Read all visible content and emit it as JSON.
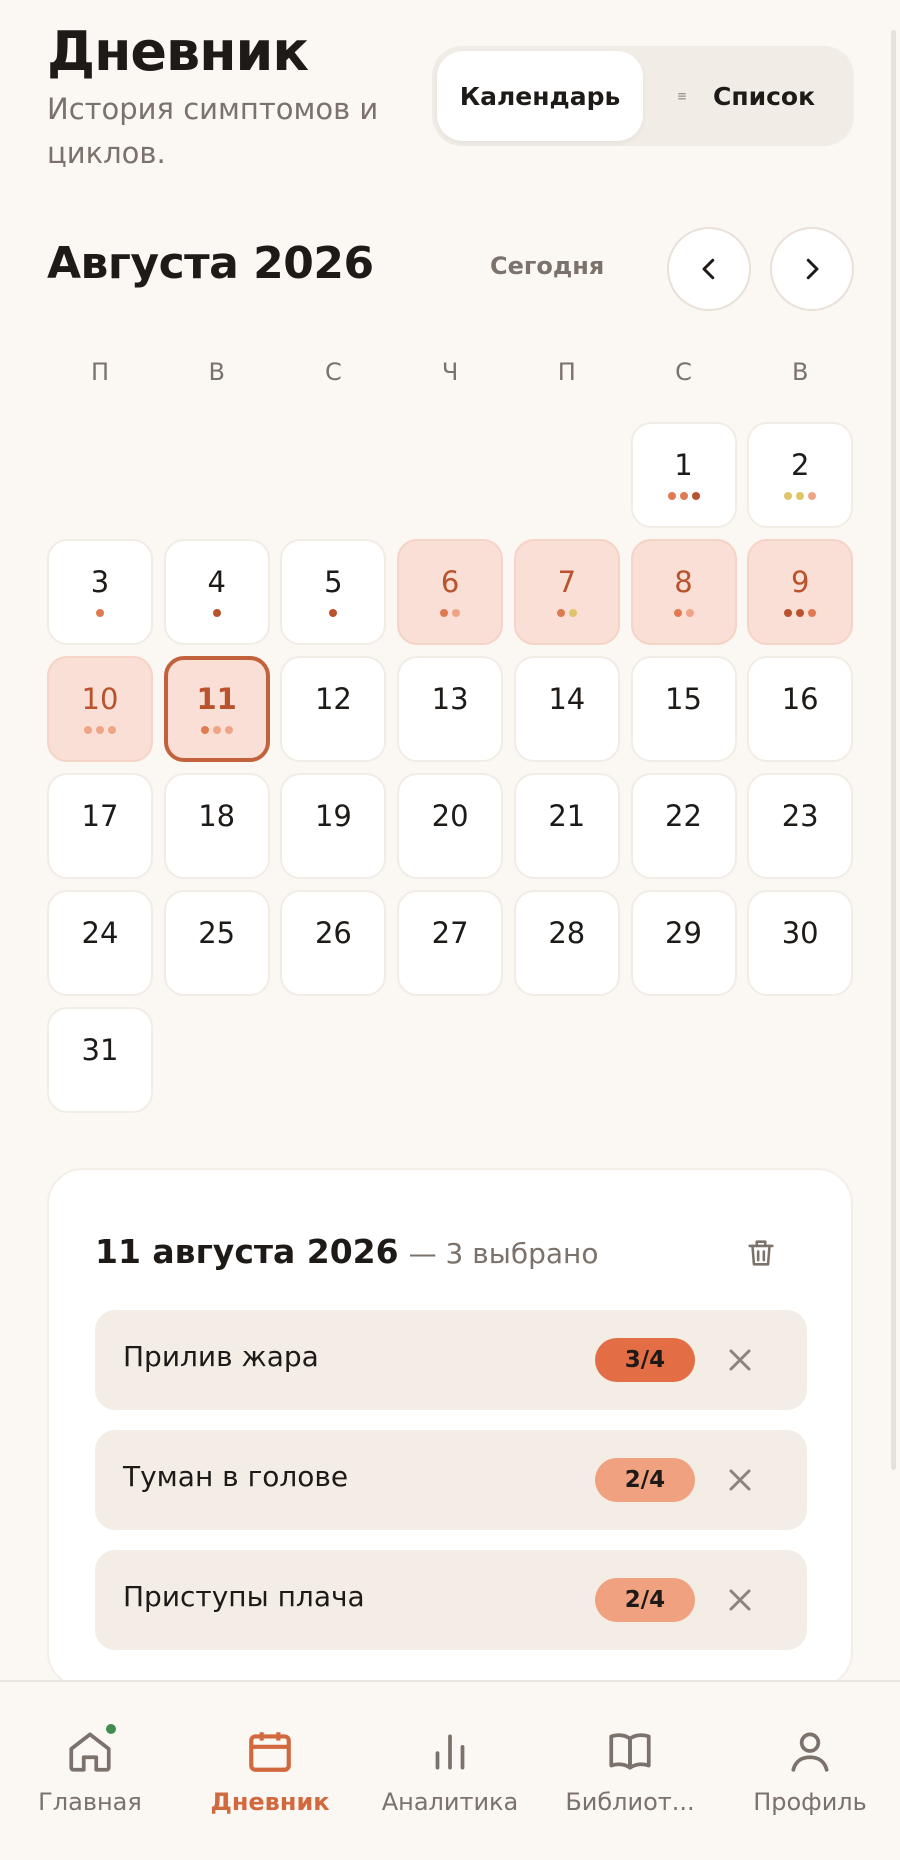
{
  "header": {
    "title": "Дневник",
    "subtitle": "История симптомов и циклов.",
    "view_calendar": "Календарь",
    "view_list": "Список"
  },
  "month": {
    "title": "Августа 2026",
    "today_label": "Сегодня"
  },
  "weekdays": [
    "П",
    "В",
    "С",
    "Ч",
    "П",
    "С",
    "В"
  ],
  "colors": {
    "accent": "#D2683E",
    "period_fill": "#F9DFD5",
    "selected_border": "#C2623C",
    "dot_dark": "#B9532D",
    "dot_mid": "#E07A50",
    "dot_light": "#EFA585",
    "dot_yellow": "#E1C46A",
    "badge_high": "#E36E45",
    "badge_mid": "#F0A17F",
    "notification": "#3E8E4F"
  },
  "days": [
    {
      "n": "1",
      "type": "normal",
      "dots": [
        "#E07A50",
        "#E07A50",
        "#B9532D"
      ]
    },
    {
      "n": "2",
      "type": "normal",
      "dots": [
        "#E1C46A",
        "#E1C46A",
        "#EFA585"
      ]
    },
    {
      "n": "3",
      "type": "normal",
      "dots": [
        "#E07A50"
      ]
    },
    {
      "n": "4",
      "type": "normal",
      "dots": [
        "#B9532D"
      ]
    },
    {
      "n": "5",
      "type": "normal",
      "dots": [
        "#B9532D"
      ]
    },
    {
      "n": "6",
      "type": "period",
      "dots": [
        "#E07A50",
        "#EFA585"
      ]
    },
    {
      "n": "7",
      "type": "period",
      "dots": [
        "#E07A50",
        "#E1C46A"
      ]
    },
    {
      "n": "8",
      "type": "period",
      "dots": [
        "#E07A50",
        "#EFA585"
      ]
    },
    {
      "n": "9",
      "type": "period",
      "dots": [
        "#B9532D",
        "#B9532D",
        "#E07A50"
      ]
    },
    {
      "n": "10",
      "type": "period",
      "dots": [
        "#EFA585",
        "#EFA585",
        "#EFA585"
      ]
    },
    {
      "n": "11",
      "type": "selected",
      "dots": [
        "#E07A50",
        "#EFA585",
        "#EFA585"
      ]
    },
    {
      "n": "12",
      "type": "normal",
      "dots": []
    },
    {
      "n": "13",
      "type": "normal",
      "dots": []
    },
    {
      "n": "14",
      "type": "normal",
      "dots": []
    },
    {
      "n": "15",
      "type": "normal",
      "dots": []
    },
    {
      "n": "16",
      "type": "normal",
      "dots": []
    },
    {
      "n": "17",
      "type": "normal",
      "dots": []
    },
    {
      "n": "18",
      "type": "normal",
      "dots": []
    },
    {
      "n": "19",
      "type": "normal",
      "dots": []
    },
    {
      "n": "20",
      "type": "normal",
      "dots": []
    },
    {
      "n": "21",
      "type": "normal",
      "dots": []
    },
    {
      "n": "22",
      "type": "normal",
      "dots": []
    },
    {
      "n": "23",
      "type": "normal",
      "dots": []
    },
    {
      "n": "24",
      "type": "normal",
      "dots": []
    },
    {
      "n": "25",
      "type": "normal",
      "dots": []
    },
    {
      "n": "26",
      "type": "normal",
      "dots": []
    },
    {
      "n": "27",
      "type": "normal",
      "dots": []
    },
    {
      "n": "28",
      "type": "normal",
      "dots": []
    },
    {
      "n": "29",
      "type": "normal",
      "dots": []
    },
    {
      "n": "30",
      "type": "normal",
      "dots": []
    },
    {
      "n": "31",
      "type": "normal",
      "dots": []
    }
  ],
  "detail": {
    "date": "11 августа 2026",
    "count": "— 3 выбрано",
    "symptoms": [
      {
        "name": "Прилив жара",
        "score": "3/4",
        "color": "#E36E45"
      },
      {
        "name": "Туман в голове",
        "score": "2/4",
        "color": "#F0A17F"
      },
      {
        "name": "Приступы плача",
        "score": "2/4",
        "color": "#F0A17F"
      }
    ]
  },
  "nav": {
    "home": "Главная",
    "diary": "Дневник",
    "analytics": "Аналитика",
    "library": "Библиот...",
    "profile": "Профиль"
  }
}
